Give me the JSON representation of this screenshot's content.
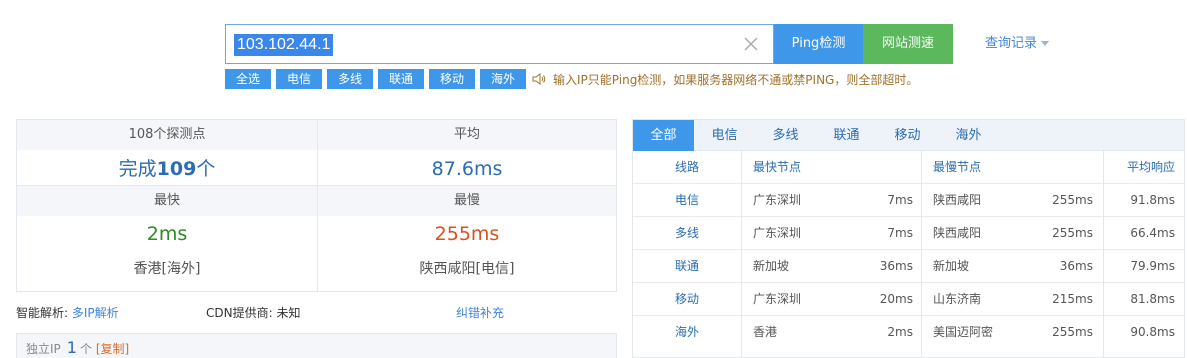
{
  "search": {
    "ip": "103.102.44.1",
    "ping_button": "Ping检测",
    "speed_button": "网站测速",
    "history": "查询记录"
  },
  "filters": [
    "全选",
    "电信",
    "多线",
    "联通",
    "移动",
    "海外"
  ],
  "hint": "输入IP只能Ping检测，如果服务器网络不通或禁PING，则全部超时。",
  "summary": {
    "probe_label": "108个探测点",
    "done_prefix": "完成",
    "done_count": "109",
    "done_suffix": "个",
    "avg_label": "平均",
    "avg_value": "87.6ms",
    "fast_label": "最快",
    "fast_value": "2ms",
    "fast_loc": "香港[海外]",
    "slow_label": "最慢",
    "slow_value": "255ms",
    "slow_loc": "陕西咸阳[电信]"
  },
  "info": {
    "dns_label": "智能解析:",
    "dns_link": "多IP解析",
    "cdn_label": "CDN提供商:",
    "cdn_value": "未知",
    "report_link": "纠错补充",
    "ip_label": "独立IP",
    "ip_count": "1",
    "ip_unit": "个",
    "copy": "[复制]"
  },
  "results": {
    "tabs": [
      "全部",
      "电信",
      "多线",
      "联通",
      "移动",
      "海外"
    ],
    "headers": {
      "line": "线路",
      "fast": "最快节点",
      "slow": "最慢节点",
      "avg": "平均响应"
    },
    "rows": [
      {
        "line": "电信",
        "fast": "广东深圳",
        "fast_ms": "7ms",
        "slow": "陕西咸阳",
        "slow_ms": "255ms",
        "avg": "91.8ms"
      },
      {
        "line": "多线",
        "fast": "广东深圳",
        "fast_ms": "7ms",
        "slow": "陕西咸阳",
        "slow_ms": "255ms",
        "avg": "66.4ms"
      },
      {
        "line": "联通",
        "fast": "新加坡",
        "fast_ms": "36ms",
        "slow": "新加坡",
        "slow_ms": "36ms",
        "avg": "79.9ms"
      },
      {
        "line": "移动",
        "fast": "广东深圳",
        "fast_ms": "20ms",
        "slow": "山东济南",
        "slow_ms": "215ms",
        "avg": "81.8ms"
      },
      {
        "line": "海外",
        "fast": "香港",
        "fast_ms": "2ms",
        "slow": "美国迈阿密",
        "slow_ms": "255ms",
        "avg": "90.8ms"
      }
    ]
  }
}
